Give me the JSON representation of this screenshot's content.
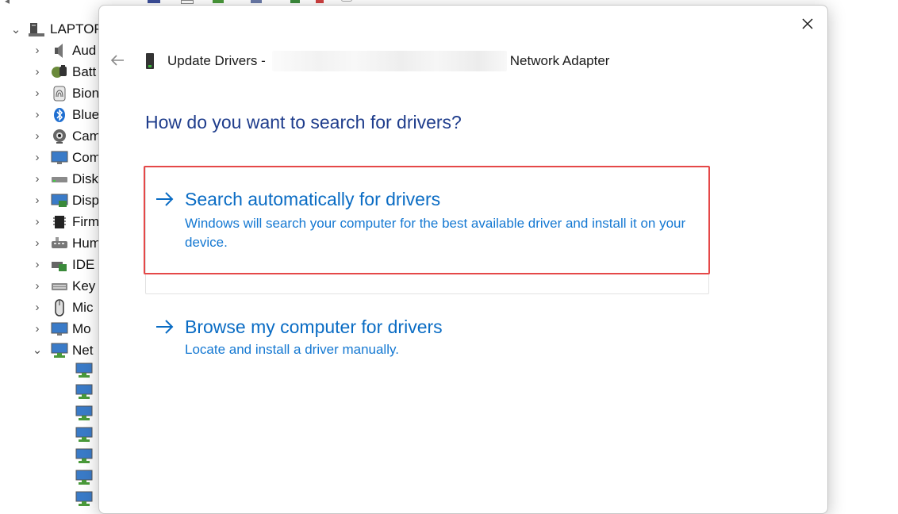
{
  "device_manager": {
    "root_label": "LAPTOP",
    "categories": [
      {
        "label": "Aud",
        "icon": "speaker-icon"
      },
      {
        "label": "Batt",
        "icon": "battery-icon"
      },
      {
        "label": "Bion",
        "icon": "fingerprint-icon"
      },
      {
        "label": "Blue",
        "icon": "bluetooth-icon"
      },
      {
        "label": "Cam",
        "icon": "camera-icon"
      },
      {
        "label": "Com",
        "icon": "computer-icon"
      },
      {
        "label": "Disk",
        "icon": "disk-drive-icon"
      },
      {
        "label": "Disp",
        "icon": "display-adapter-icon"
      },
      {
        "label": "Firm",
        "icon": "firmware-icon"
      },
      {
        "label": "Hum",
        "icon": "hid-icon"
      },
      {
        "label": "IDE",
        "icon": "ide-controller-icon"
      },
      {
        "label": "Key",
        "icon": "keyboard-icon"
      },
      {
        "label": "Mic",
        "icon": "mouse-icon"
      },
      {
        "label": "Mo",
        "icon": "monitor-icon"
      },
      {
        "label": "Net",
        "icon": "network-adapter-icon"
      }
    ],
    "network_children_count_visible": 7
  },
  "dialog": {
    "title_prefix": "Update Drivers -",
    "title_suffix": "Network Adapter",
    "question": "How do you want to search for drivers?",
    "options": [
      {
        "title": "Search automatically for drivers",
        "description": "Windows will search your computer for the best available driver and install it on your device.",
        "highlighted": true
      },
      {
        "title": "Browse my computer for drivers",
        "description": "Locate and install a driver manually.",
        "highlighted": false
      }
    ]
  },
  "colors": {
    "question_text": "#1f3d8c",
    "link_text": "#0a6cc4",
    "highlight_border": "#e54848"
  }
}
